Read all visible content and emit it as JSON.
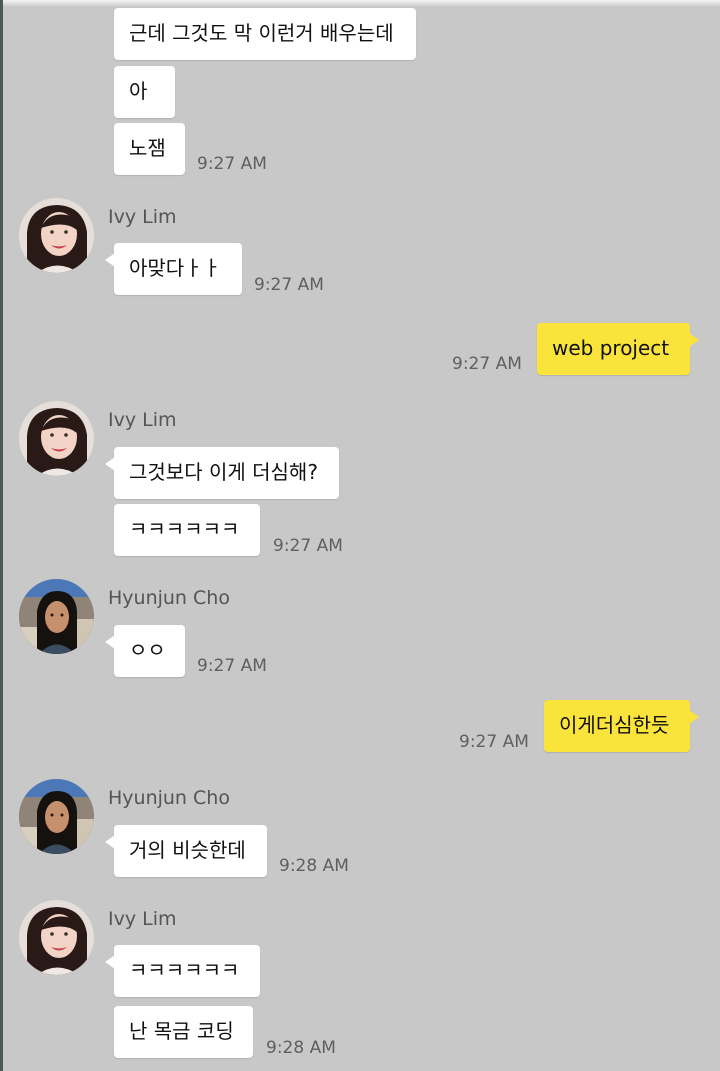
{
  "messages": [
    {
      "text": "근데 그것도 막 이런거 배우는데"
    },
    {
      "text": "아"
    },
    {
      "text": "노잼",
      "time": "9:27 AM"
    },
    {
      "sender": "Ivy Lim",
      "text": "아맞다ㅏㅏ",
      "time": "9:27 AM"
    },
    {
      "text": "web project",
      "time": "9:27 AM"
    },
    {
      "sender": "Ivy Lim",
      "text": "그것보다 이게 더심해?"
    },
    {
      "text": "ㅋㅋㅋㅋㅋㅋ",
      "time": "9:27 AM"
    },
    {
      "sender": "Hyunjun Cho",
      "text": "ㅇㅇ",
      "time": "9:27 AM"
    },
    {
      "text": "이게더심한듯",
      "time": "9:27 AM"
    },
    {
      "sender": "Hyunjun Cho",
      "text": "거의 비슷한데",
      "time": "9:28 AM"
    },
    {
      "sender": "Ivy Lim",
      "text": "ㅋㅋㅋㅋㅋㅋ"
    },
    {
      "text": "난 목금 코딩",
      "time": "9:28 AM"
    }
  ],
  "colors": {
    "background": "#c8c8c8",
    "incoming_bubble": "#ffffff",
    "outgoing_bubble": "#fae43b",
    "time_text": "#5f5f5f"
  },
  "icons": {
    "ivy_avatar": "avatar-ivy-lim-icon",
    "hyunjun_avatar": "avatar-hyunjun-cho-icon"
  }
}
